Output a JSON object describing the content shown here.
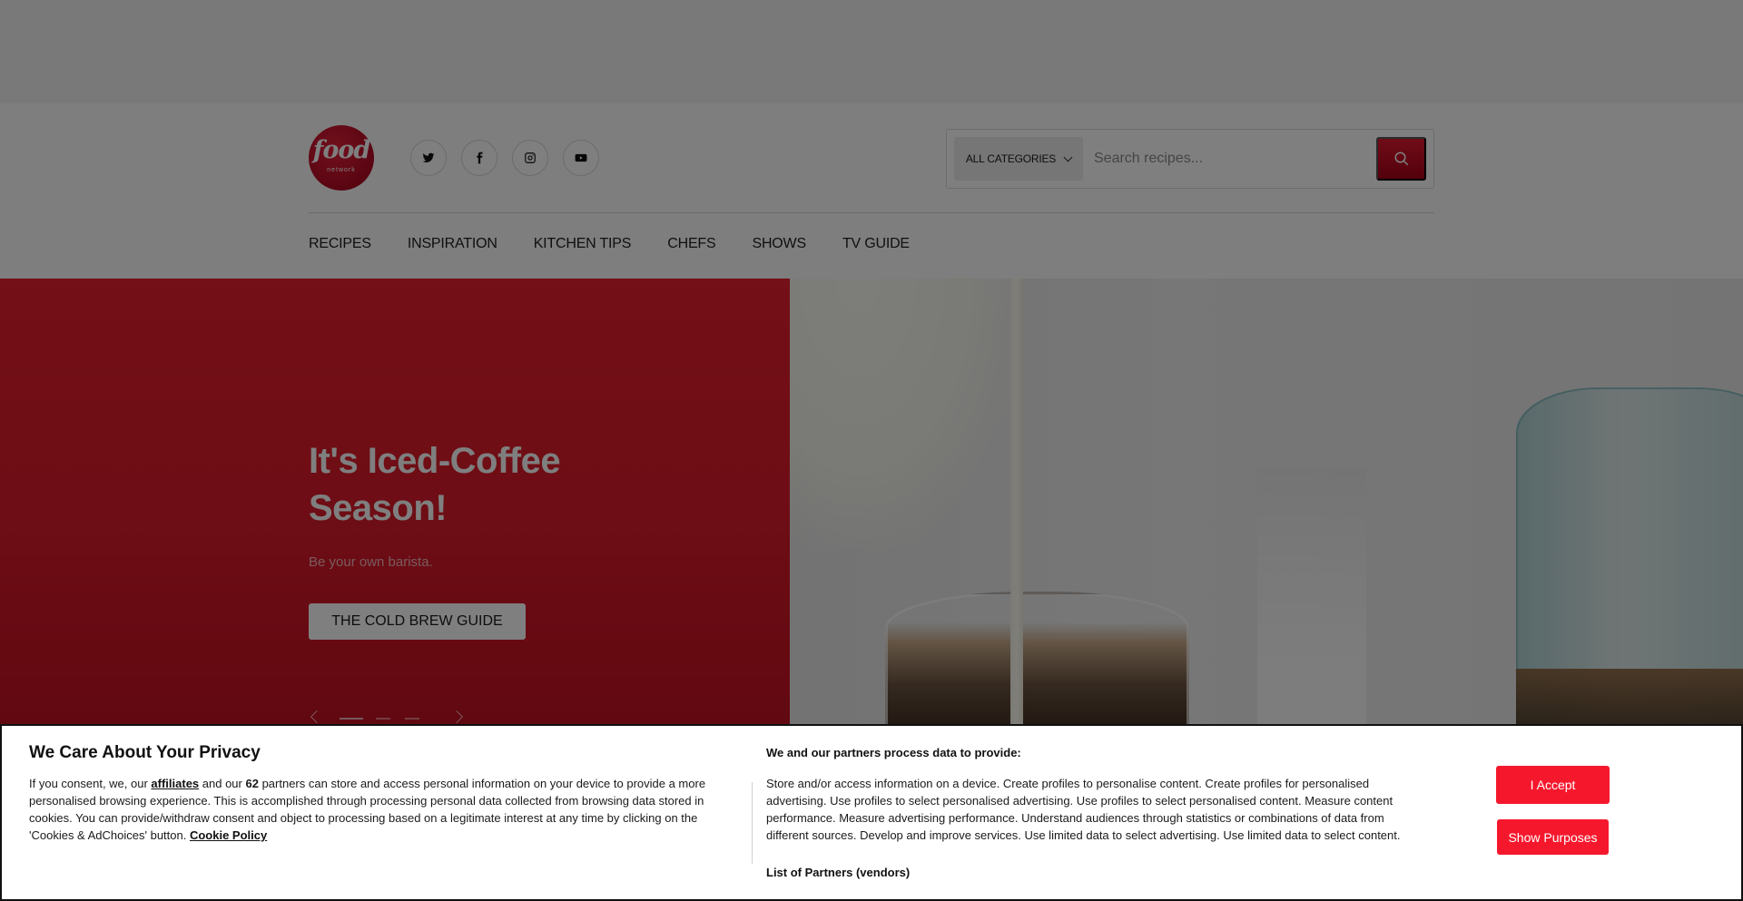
{
  "header": {
    "logo": {
      "word": "food",
      "sub": "network"
    },
    "social": [
      {
        "name": "twitter-icon"
      },
      {
        "name": "facebook-icon"
      },
      {
        "name": "instagram-icon"
      },
      {
        "name": "youtube-icon"
      }
    ],
    "search": {
      "category_label": "ALL CATEGORIES",
      "placeholder": "Search recipes...",
      "value": ""
    },
    "nav": [
      "RECIPES",
      "INSPIRATION",
      "KITCHEN TIPS",
      "CHEFS",
      "SHOWS",
      "TV GUIDE"
    ]
  },
  "hero": {
    "title": "It's Iced-Coffee Season!",
    "subtitle": "Be your own barista.",
    "cta_label": "THE COLD BREW GUIDE",
    "slides_total": 3,
    "active_slide": 1
  },
  "consent": {
    "title": "We Care About Your Privacy",
    "text_1": "If you consent, we, our ",
    "affiliates_link": "affiliates",
    "text_2": " and our ",
    "partner_count": "62",
    "text_3": " partners can store and access personal information on your device to provide a more personalised browsing experience. This is accomplished through processing personal data collected from browsing data stored in cookies. You can provide/withdraw consent and object to processing based on a legitimate interest at any time by clicking on the 'Cookies & AdChoices' button. ",
    "cookie_policy_link": "Cookie Policy",
    "purposes_title": "We and our partners process data to provide:",
    "purposes_text": "Store and/or access information on a device. Create profiles to personalise content. Create profiles for personalised advertising. Use profiles to select personalised advertising. Use profiles to select personalised content. Measure content performance. Measure advertising performance. Understand audiences through statistics or combinations of data from different sources. Develop and improve services. Use limited data to select advertising. Use limited data to select content.",
    "partners_link": "List of Partners (vendors)",
    "accept_label": "I Accept",
    "show_purposes_label": "Show Purposes",
    "button_color": "#f5182d"
  }
}
